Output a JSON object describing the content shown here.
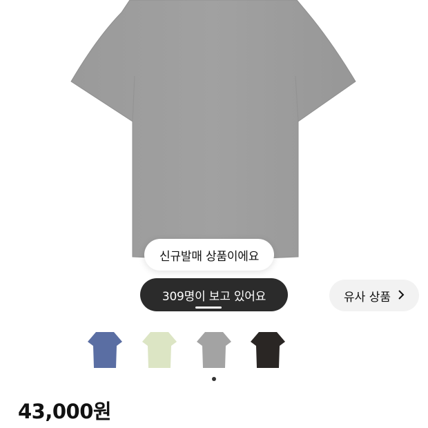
{
  "product": {
    "badge_new": "신규발매 상품이에요",
    "badge_views": "309명이 보고 있어요",
    "similar_button": "유사 상품",
    "price": "43,000원"
  },
  "colors": {
    "main_tee": "#9d9d9d",
    "badge_dark": "#2b2b2b",
    "chip_bg": "#f2f2f2"
  },
  "swatches": [
    {
      "name": "blue",
      "color": "#5a6ea3"
    },
    {
      "name": "mint",
      "color": "#dce5c4"
    },
    {
      "name": "gray",
      "color": "#a3a3a3"
    },
    {
      "name": "black",
      "color": "#2a2624"
    }
  ],
  "icons": {
    "similar_chevron": "chevron-right-icon"
  }
}
